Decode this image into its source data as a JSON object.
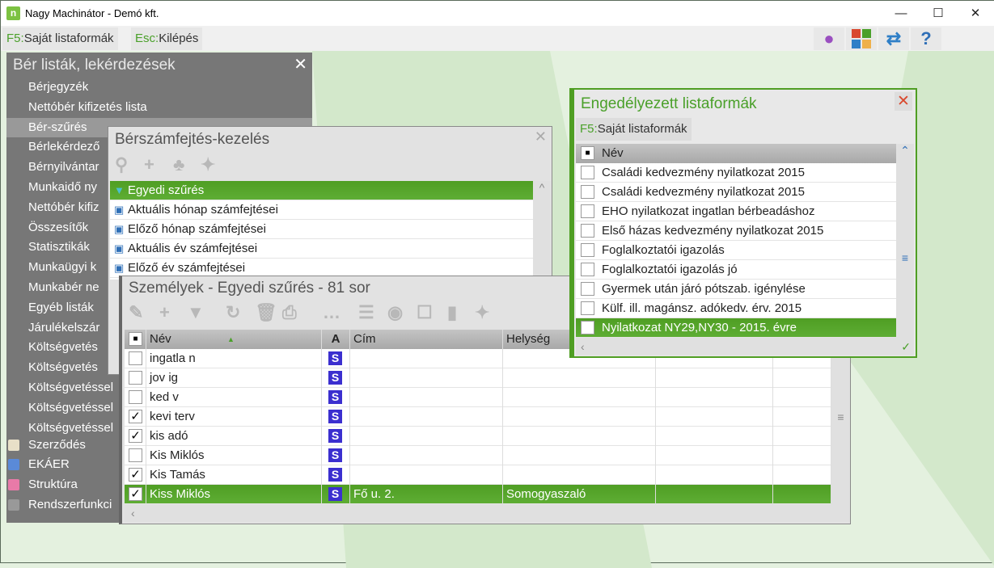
{
  "window": {
    "title": "Nagy Machinátor - Demó kft.",
    "logo": "n"
  },
  "toolbar": {
    "f5_key": "F5:",
    "f5_label": "Saját listaformák",
    "esc_key": "Esc:",
    "esc_label": "Kilépés"
  },
  "left_panel": {
    "title": "Bér listák, lekérdezések",
    "items": [
      "Bérjegyzék",
      "Nettóbér kifizetés lista",
      "Bér-szűrés",
      "Bérlekérdező",
      "Bérnyilvántar",
      "Munkaidő ny",
      "Nettóbér kifiz",
      "Összesítők",
      "Statisztikák",
      "Munkaügyi k",
      "Munkabér ne",
      "Egyéb listák",
      "Járulékelszár",
      "Költségvetés",
      "Költségvetés",
      "Költségvetéssel",
      "Költségvetéssel",
      "Költségvetéssel",
      "Szerződés",
      "EKÁER",
      "Struktúra",
      "Rendszerfunkci"
    ]
  },
  "berszamfejtes": {
    "title": "Bérszámfejtés-kezelés",
    "items": [
      "Egyedi szűrés",
      "Aktuális hónap számfejtései",
      "Előző hónap számfejtései",
      "Aktuális év számfejtései",
      "Előző év számfejtései"
    ]
  },
  "szemelyek": {
    "title": "Személyek - Egyedi szűrés - 81 sor",
    "columns": {
      "nev": "Név",
      "a": "A",
      "cim": "Cím",
      "helyseg": "Helység"
    },
    "badge": "S",
    "rows": [
      {
        "nev": "ingatla n",
        "checked": false,
        "cim": "",
        "helyseg": ""
      },
      {
        "nev": "jov ig",
        "checked": false,
        "cim": "",
        "helyseg": ""
      },
      {
        "nev": "ked v",
        "checked": false,
        "cim": "",
        "helyseg": ""
      },
      {
        "nev": "kevi terv",
        "checked": true,
        "cim": "",
        "helyseg": ""
      },
      {
        "nev": "kis adó",
        "checked": true,
        "cim": "",
        "helyseg": ""
      },
      {
        "nev": "Kis Miklós",
        "checked": false,
        "cim": "",
        "helyseg": ""
      },
      {
        "nev": "Kis Tamás",
        "checked": true,
        "cim": "",
        "helyseg": ""
      },
      {
        "nev": "Kiss Miklós",
        "checked": true,
        "cim": "Fő u. 2.",
        "helyseg": "Somogyaszaló",
        "selected": true
      }
    ]
  },
  "engedelyezett": {
    "title": "Engedélyezett listaformák",
    "f5_key": "F5:",
    "f5_label": "Saját listaformák",
    "column": "Név",
    "rows": [
      "Családi kedvezmény nyilatkozat 2015",
      "Családi kedvezmény nyilatkozat 2015",
      "EHO nyilatkozat ingatlan bérbeadáshoz",
      "Első házas kedvezmény nyilatkozat 2015",
      "Foglalkoztatói igazolás",
      "Foglalkoztatói igazolás jó",
      "Gyermek után járó pótszab. igénylése",
      "Külf. ill. magánsz. adókedv. érv. 2015",
      "Nyilatkozat NY29,NY30 - 2015. évre"
    ],
    "selected_index": 8
  },
  "colors": {
    "accent": "#4f9e23",
    "badge": "#3b2fcf"
  }
}
